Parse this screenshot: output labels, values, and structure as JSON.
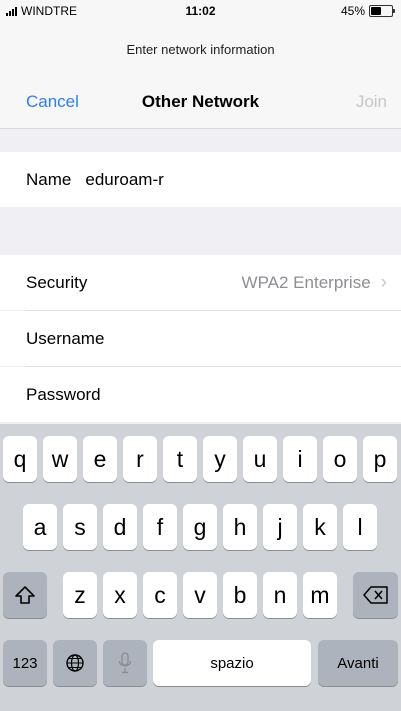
{
  "status_bar": {
    "carrier": "WINDTRE",
    "time": "11:02",
    "battery": "45%",
    "battery_level": 0.45
  },
  "prompt": "Enter network information",
  "nav": {
    "cancel": "Cancel",
    "title": "Other Network",
    "join": "Join"
  },
  "form": {
    "name_label": "Name",
    "name_value": "eduroam-r",
    "security_label": "Security",
    "security_value": "WPA2 Enterprise",
    "username_label": "Username",
    "password_label": "Password"
  },
  "keyboard": {
    "row1": [
      "q",
      "w",
      "e",
      "r",
      "t",
      "y",
      "u",
      "i",
      "o",
      "p"
    ],
    "row2": [
      "a",
      "s",
      "d",
      "f",
      "g",
      "h",
      "j",
      "k",
      "l"
    ],
    "row3": [
      "z",
      "x",
      "c",
      "v",
      "b",
      "n",
      "m"
    ],
    "numbers_key": "123",
    "space_key": "spazio",
    "return_key": "Avanti"
  },
  "colors": {
    "accent": "#2f7df6",
    "disabled": "#c8c8cc",
    "secondary_text": "#8e8e93"
  }
}
